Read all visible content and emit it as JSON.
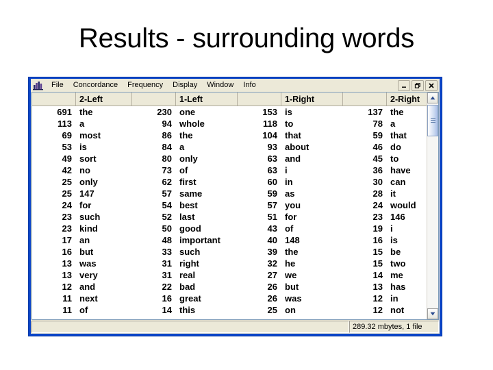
{
  "slide": {
    "title": "Results - surrounding words"
  },
  "window": {
    "icon": "bar-chart-icon",
    "menu_items": [
      "File",
      "Concordance",
      "Frequency",
      "Display",
      "Window",
      "Info"
    ],
    "controls": {
      "minimize": "minimize-icon",
      "restore": "restore-icon",
      "close": "close-icon"
    },
    "status": {
      "left": "",
      "right": "289.32 mbytes, 1 file"
    },
    "scrollbar": {
      "up": "scroll-up-arrow",
      "down": "scroll-down-arrow"
    }
  },
  "table": {
    "headers": [
      "",
      "2-Left",
      "",
      "1-Left",
      "",
      "1-Right",
      "",
      "2-Right"
    ],
    "column_groups": [
      {
        "count_header": "",
        "word_header": "2-Left"
      },
      {
        "count_header": "",
        "word_header": "1-Left"
      },
      {
        "count_header": "",
        "word_header": "1-Right"
      },
      {
        "count_header": "",
        "word_header": "2-Right"
      }
    ],
    "rows": [
      {
        "c1": "691",
        "w1": "the",
        "c2": "230",
        "w2": "one",
        "c3": "153",
        "w3": "is",
        "c4": "137",
        "w4": "the"
      },
      {
        "c1": "113",
        "w1": "a",
        "c2": "94",
        "w2": "whole",
        "c3": "118",
        "w3": "to",
        "c4": "78",
        "w4": "a"
      },
      {
        "c1": "69",
        "w1": "most",
        "c2": "86",
        "w2": "the",
        "c3": "104",
        "w3": "that",
        "c4": "59",
        "w4": "that"
      },
      {
        "c1": "53",
        "w1": "is",
        "c2": "84",
        "w2": "a",
        "c3": "93",
        "w3": "about",
        "c4": "46",
        "w4": "do"
      },
      {
        "c1": "49",
        "w1": "sort",
        "c2": "80",
        "w2": "only",
        "c3": "63",
        "w3": "and",
        "c4": "45",
        "w4": "to"
      },
      {
        "c1": "42",
        "w1": "no",
        "c2": "73",
        "w2": "of",
        "c3": "63",
        "w3": "i",
        "c4": "36",
        "w4": "have"
      },
      {
        "c1": "25",
        "w1": "only",
        "c2": "62",
        "w2": "first",
        "c3": "60",
        "w3": "in",
        "c4": "30",
        "w4": "can"
      },
      {
        "c1": "25",
        "w1": "147",
        "c2": "57",
        "w2": "same",
        "c3": "59",
        "w3": "as",
        "c4": "28",
        "w4": "it"
      },
      {
        "c1": "24",
        "w1": "for",
        "c2": "54",
        "w2": "best",
        "c3": "57",
        "w3": "you",
        "c4": "24",
        "w4": "would"
      },
      {
        "c1": "23",
        "w1": "such",
        "c2": "52",
        "w2": "last",
        "c3": "51",
        "w3": "for",
        "c4": "23",
        "w4": "146"
      },
      {
        "c1": "23",
        "w1": "kind",
        "c2": "50",
        "w2": "good",
        "c3": "43",
        "w3": "of",
        "c4": "19",
        "w4": "i"
      },
      {
        "c1": "17",
        "w1": "an",
        "c2": "48",
        "w2": "important",
        "c3": "40",
        "w3": "148",
        "c4": "16",
        "w4": "is"
      },
      {
        "c1": "16",
        "w1": "but",
        "c2": "33",
        "w2": "such",
        "c3": "39",
        "w3": "the",
        "c4": "15",
        "w4": "be"
      },
      {
        "c1": "13",
        "w1": "was",
        "c2": "31",
        "w2": "right",
        "c3": "32",
        "w3": "he",
        "c4": "15",
        "w4": "two"
      },
      {
        "c1": "13",
        "w1": "very",
        "c2": "31",
        "w2": "real",
        "c3": "27",
        "w3": "we",
        "c4": "14",
        "w4": "me"
      },
      {
        "c1": "12",
        "w1": "and",
        "c2": "22",
        "w2": "bad",
        "c3": "26",
        "w3": "but",
        "c4": "13",
        "w4": "has"
      },
      {
        "c1": "11",
        "w1": "next",
        "c2": "16",
        "w2": "great",
        "c3": "26",
        "w3": "was",
        "c4": "12",
        "w4": "in"
      },
      {
        "c1": "11",
        "w1": "of",
        "c2": "14",
        "w2": "this",
        "c3": "25",
        "w3": "on",
        "c4": "12",
        "w4": "not"
      }
    ]
  }
}
